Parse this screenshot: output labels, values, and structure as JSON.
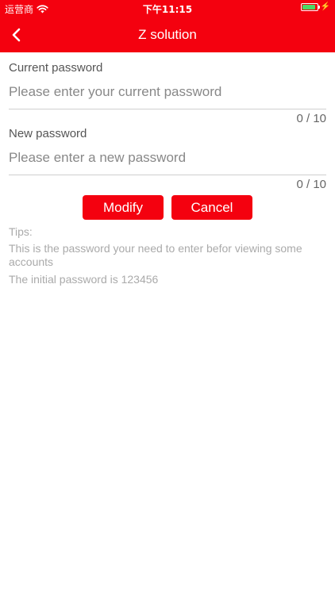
{
  "status_bar": {
    "carrier": "运营商",
    "time": "下午11:15",
    "battery_level": 0.9
  },
  "nav": {
    "title": "Z solution"
  },
  "form": {
    "current_password": {
      "label": "Current password",
      "placeholder": "Please enter your current password",
      "value": "",
      "counter": "0 / 10"
    },
    "new_password": {
      "label": "New password",
      "placeholder": "Please enter a new password",
      "value": "",
      "counter": "0 / 10"
    }
  },
  "actions": {
    "modify_label": "Modify",
    "cancel_label": "Cancel"
  },
  "tips": {
    "title": "Tips:",
    "lines": [
      "This is the password your need to enter befor viewing some accounts",
      "The initial password is 123456"
    ]
  },
  "colors": {
    "accent": "#f4010f",
    "battery": "#4cd964"
  }
}
